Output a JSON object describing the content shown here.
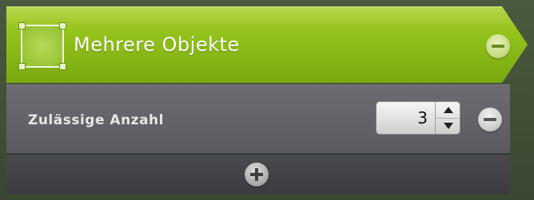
{
  "header": {
    "title": "Mehrere Objekte",
    "icon": "selection-frame-icon",
    "remove_icon": "minus-circle-icon",
    "color": "#8fbf1a"
  },
  "setting": {
    "label": "Zulässige Anzahl",
    "value": "3",
    "remove_icon": "minus-circle-icon"
  },
  "footer": {
    "add_icon": "plus-circle-icon"
  }
}
